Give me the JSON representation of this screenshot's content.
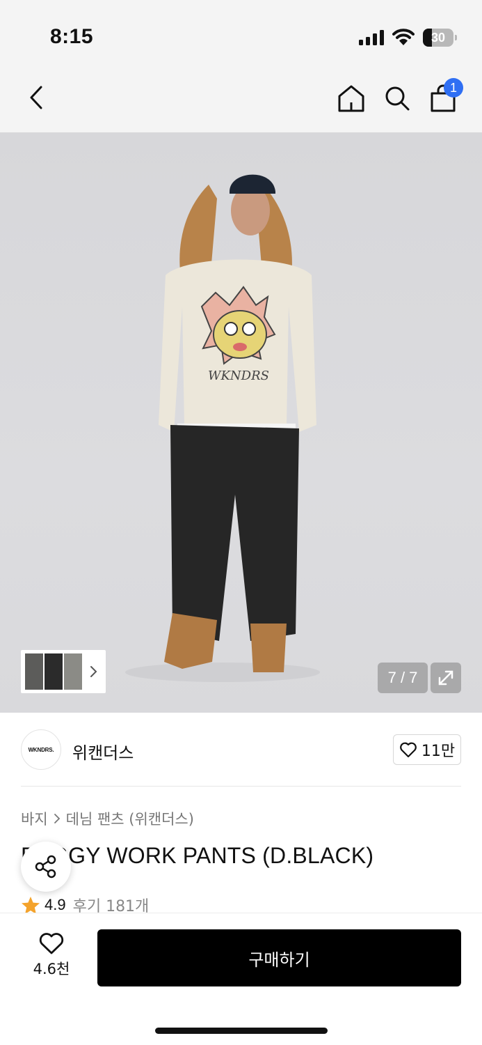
{
  "status_bar": {
    "time": "8:15",
    "battery_level": "30"
  },
  "nav": {
    "cart_count": "1"
  },
  "gallery": {
    "counter": "7 / 7",
    "current_index": 7,
    "total": 7,
    "thumbnail_colors": [
      "#5c5c5a",
      "#2b2b2b",
      "#8b8b86"
    ]
  },
  "brand": {
    "logo_text": "WKNDRS.",
    "name": "위캔더스",
    "like_count": "11만"
  },
  "product": {
    "breadcrumb": [
      "바지",
      "데님 팬츠 (위캔더스)"
    ],
    "title": "BAGGY WORK PANTS (D.BLACK)",
    "rating": "4.9",
    "review_label": "후기 181개"
  },
  "bottom_bar": {
    "wish_count": "4.6천",
    "buy_label": "구매하기"
  },
  "colors": {
    "accent_blue": "#2f6ff3",
    "star": "#f4a32c",
    "buy_button": "#000000"
  }
}
